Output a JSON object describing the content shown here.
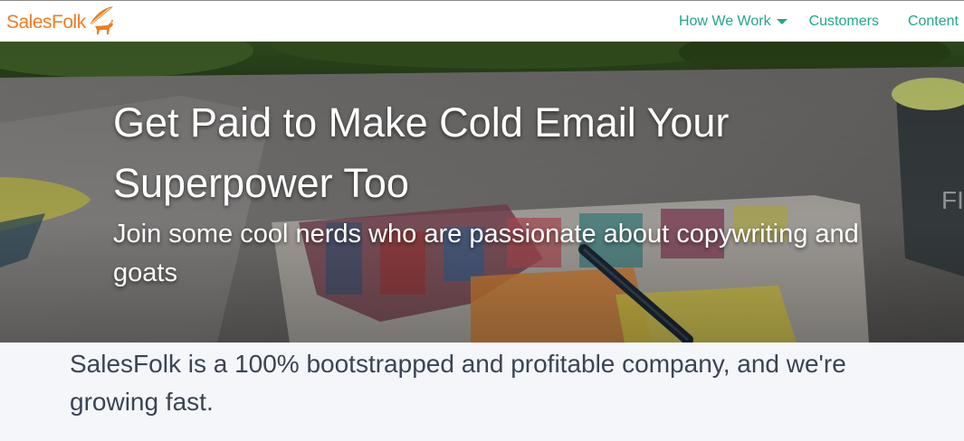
{
  "brand": {
    "name": "SalesFolk",
    "logo_icon": "goat-icon",
    "color": "#ef7d22"
  },
  "nav": {
    "accent": "#22a58a",
    "items": [
      {
        "label": "How We Work",
        "has_dropdown": true
      },
      {
        "label": "Customers"
      },
      {
        "label": "Content"
      }
    ]
  },
  "hero": {
    "title": "Get Paid to Make Cold Email Your Superpower Too",
    "subtitle": "Join some cool nerds who are passionate about copywriting and goats"
  },
  "intro": {
    "text": "SalesFolk is a 100% bootstrapped and profitable company, and we're growing fast."
  }
}
